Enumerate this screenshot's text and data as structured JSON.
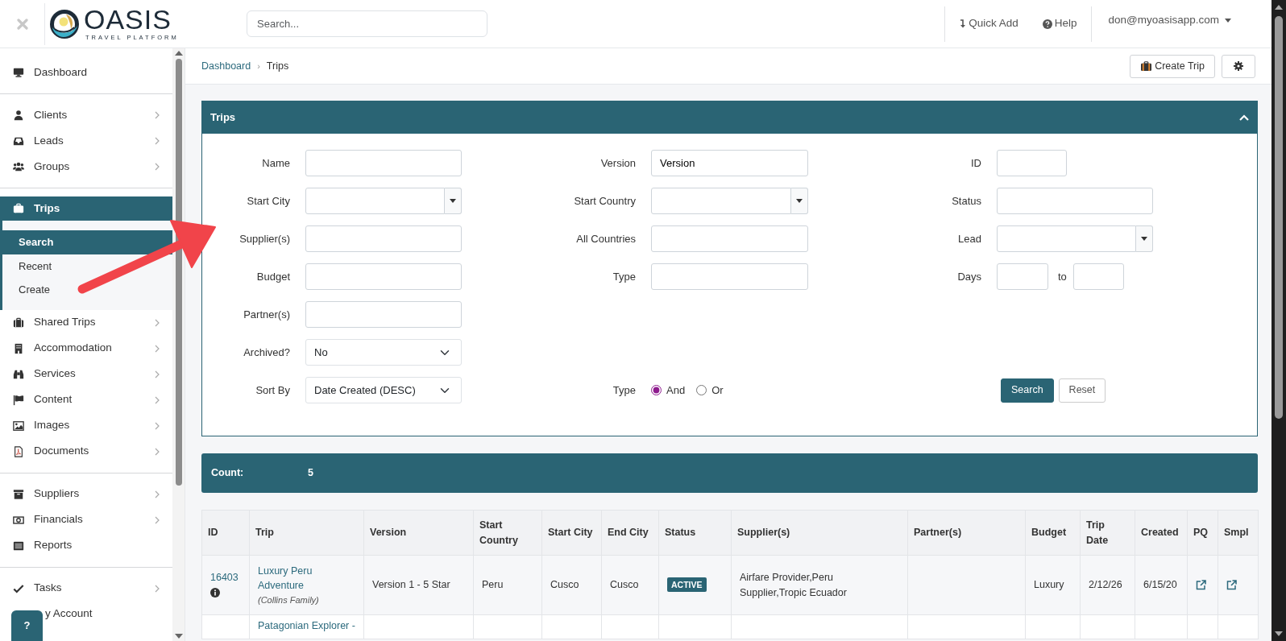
{
  "header": {
    "logo": {
      "name": "OASIS",
      "tagline": "TRAVEL PLATFORM"
    },
    "search_placeholder": "Search...",
    "actions": [
      {
        "label": "Quick Add",
        "kind": "quick-add"
      },
      {
        "label": "Help",
        "kind": "help"
      }
    ],
    "user": "don@myoasisapp.com"
  },
  "sidebar": {
    "groups": [
      [
        {
          "label": "Dashboard",
          "expandable": false,
          "expanded": false
        }
      ],
      [
        {
          "label": "Clients",
          "expandable": true,
          "expanded": false
        },
        {
          "label": "Leads",
          "expandable": true,
          "expanded": false
        },
        {
          "label": "Groups",
          "expandable": true,
          "expanded": false
        }
      ],
      [
        {
          "label": "Trips",
          "expandable": true,
          "expanded": true,
          "children": [
            {
              "label": "Search",
              "selected": true
            },
            {
              "label": "Recent",
              "selected": false
            },
            {
              "label": "Create",
              "selected": false
            }
          ]
        },
        {
          "label": "Shared Trips",
          "expandable": true,
          "expanded": false
        },
        {
          "label": "Accommodation",
          "expandable": true,
          "expanded": false
        },
        {
          "label": "Services",
          "expandable": true,
          "expanded": false
        },
        {
          "label": "Content",
          "expandable": true,
          "expanded": false
        },
        {
          "label": "Images",
          "expandable": true,
          "expanded": false
        },
        {
          "label": "Documents",
          "expandable": true,
          "expanded": false
        }
      ],
      [
        {
          "label": "Suppliers",
          "expandable": true,
          "expanded": false
        },
        {
          "label": "Financials",
          "expandable": true,
          "expanded": false
        },
        {
          "label": "Reports",
          "expandable": false,
          "expanded": false
        }
      ],
      [
        {
          "label": "Tasks",
          "expandable": true,
          "expanded": false
        },
        {
          "label": "y Account",
          "expandable": false,
          "expanded": false
        }
      ]
    ]
  },
  "help_button": "?",
  "breadcrumb": {
    "items": [
      {
        "label": "Dashboard",
        "link": true
      },
      {
        "label": "Trips",
        "link": false
      }
    ],
    "separator": "›"
  },
  "toolbar": {
    "create_label": "Create Trip"
  },
  "search_panel": {
    "title": "Trips",
    "expanded": true,
    "rows": [
      [
        {
          "kind": "text",
          "label": "Name"
        },
        {
          "kind": "text",
          "label": "Version",
          "value": "Version"
        },
        {
          "kind": "short",
          "label": "ID"
        }
      ],
      [
        {
          "kind": "combo",
          "label": "Start City"
        },
        {
          "kind": "combo",
          "label": "Start Country"
        },
        {
          "kind": "text",
          "label": "Status"
        }
      ],
      [
        {
          "kind": "text",
          "label": "Supplier(s)"
        },
        {
          "kind": "text",
          "label": "All Countries"
        },
        {
          "kind": "combo",
          "label": "Lead"
        }
      ],
      [
        {
          "kind": "text",
          "label": "Budget"
        },
        {
          "kind": "text",
          "label": "Type"
        },
        {
          "kind": "range",
          "label": "Days",
          "joiner": "to"
        }
      ],
      [
        {
          "kind": "text",
          "label": "Partner(s)"
        },
        {
          "kind": "blank"
        },
        {
          "kind": "blank"
        }
      ],
      [
        {
          "kind": "select",
          "label": "Archived?",
          "value": "No"
        },
        {
          "kind": "blank"
        },
        {
          "kind": "blank"
        }
      ],
      [
        {
          "kind": "select",
          "label": "Sort By",
          "value": "Date Created (DESC)"
        },
        {
          "kind": "radio",
          "label": "Type",
          "options": [
            {
              "label": "And",
              "selected": true
            },
            {
              "label": "Or",
              "selected": false
            }
          ]
        },
        {
          "kind": "buttons",
          "buttons": [
            {
              "label": "Search",
              "primary": true
            },
            {
              "label": "Reset",
              "primary": false
            }
          ]
        }
      ]
    ]
  },
  "count": {
    "label": "Count:",
    "value": "5"
  },
  "table": {
    "columns": [
      "ID",
      "Trip",
      "Version",
      "Start Country",
      "Start City",
      "End City",
      "Status",
      "Supplier(s)",
      "Partner(s)",
      "Budget",
      "Trip Date",
      "Created",
      "PQ",
      "Smpl"
    ],
    "rows": [
      {
        "id": "16403",
        "info": true,
        "trip": "Luxury Peru Adventure",
        "client": "(Collins Family)",
        "version": "Version 1 - 5 Star",
        "start_country": "Peru",
        "start_city": "Cusco",
        "end_city": "Cusco",
        "status": "ACTIVE",
        "suppliers": "Airfare Provider,Peru Supplier,Tropic Ecuador",
        "budget": "Luxury",
        "trip_date": "2/12/26",
        "created": "6/15/20",
        "pq_link": true,
        "smpl_link": true
      },
      {
        "trip": "Patagonian Explorer -",
        "info": false,
        "pq_link": false,
        "smpl_link": false
      }
    ]
  }
}
